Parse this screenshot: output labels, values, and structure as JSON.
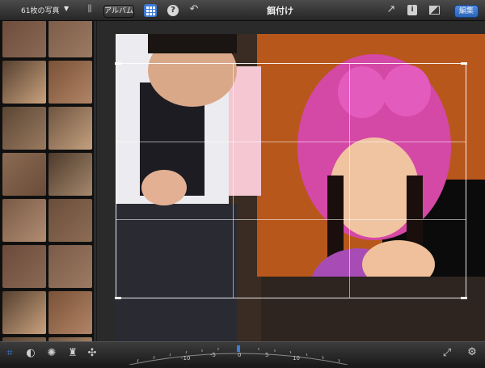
{
  "sidebar": {
    "photo_count": "61枚の写真",
    "thumb_colors": [
      [
        "#6b4a3a",
        "#8a6a55"
      ],
      [
        "#7b5a48",
        "#9b7b62"
      ],
      [
        "#55402f",
        "#caa27e"
      ],
      [
        "#7a5237",
        "#b18466"
      ],
      [
        "#5a4634",
        "#9a7a60"
      ],
      [
        "#6e5440",
        "#c4a07e"
      ],
      [
        "#8a6a52",
        "#6a4d3a"
      ],
      [
        "#4d3a2b",
        "#a5886d"
      ],
      [
        "#7a5a45",
        "#b08c72"
      ],
      [
        "#6a4e3a",
        "#8d6c55"
      ]
    ]
  },
  "toolbar": {
    "album_label": "アルバム",
    "title": "餌付け",
    "edit_label": "編集"
  },
  "colors": {
    "accent_blue": "#3d7ad6",
    "hood_pink": "#d448a6",
    "wall_brown": "#b8571c"
  },
  "dial": {
    "ticks": [
      "-10",
      "-5",
      "0",
      "5",
      "10"
    ]
  }
}
